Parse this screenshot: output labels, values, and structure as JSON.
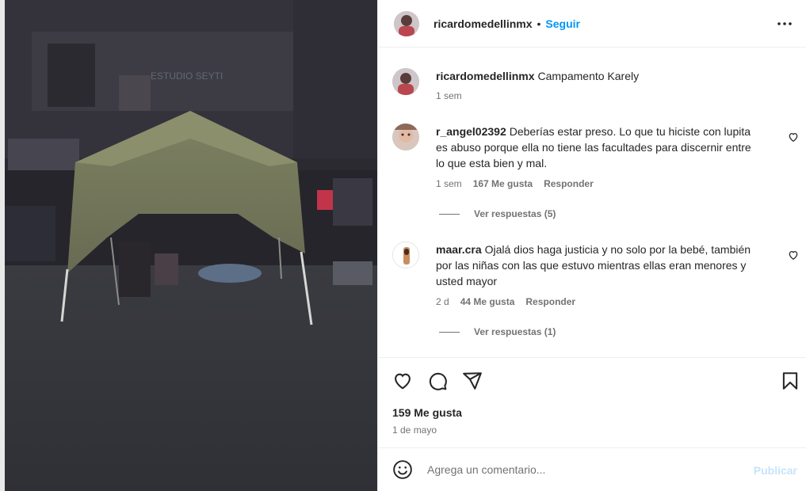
{
  "post": {
    "username": "ricardomedellinmx",
    "follow_label": "Seguir",
    "dot": "•",
    "caption_user": "ricardomedellinmx",
    "caption_text": "Campamento Karely",
    "caption_time": "1 sem",
    "photo_sign_text": "ESTUDIO SEYTI"
  },
  "comments": [
    {
      "user": "r_angel02392",
      "text": "Deberías estar preso. Lo que tu hiciste con lupita es abuso porque ella no tiene las facultades para discernir entre lo que esta bien y mal.",
      "time": "1 sem",
      "likes": "167 Me gusta",
      "reply_label": "Responder",
      "view_replies": "Ver respuestas (5)"
    },
    {
      "user": "maar.cra",
      "text": "Ojalá dios haga justicia y no solo por la bebé, también por las niñas con las que estuvo mientras ellas eran menores y usted mayor",
      "time": "2 d",
      "likes": "44 Me gusta",
      "reply_label": "Responder",
      "view_replies": "Ver respuestas (1)"
    }
  ],
  "footer": {
    "likes": "159 Me gusta",
    "date": "1 de mayo",
    "comment_placeholder": "Agrega un comentario...",
    "publish_label": "Publicar"
  },
  "icons": {
    "more": "more-options-icon",
    "like": "heart-icon",
    "comment": "comment-icon",
    "share": "share-icon",
    "save": "bookmark-icon",
    "emoji": "emoji-icon"
  },
  "colors": {
    "accent": "#0095f6",
    "publish_disabled": "#c6e3fb",
    "muted_text": "#737373",
    "text": "#262626"
  }
}
